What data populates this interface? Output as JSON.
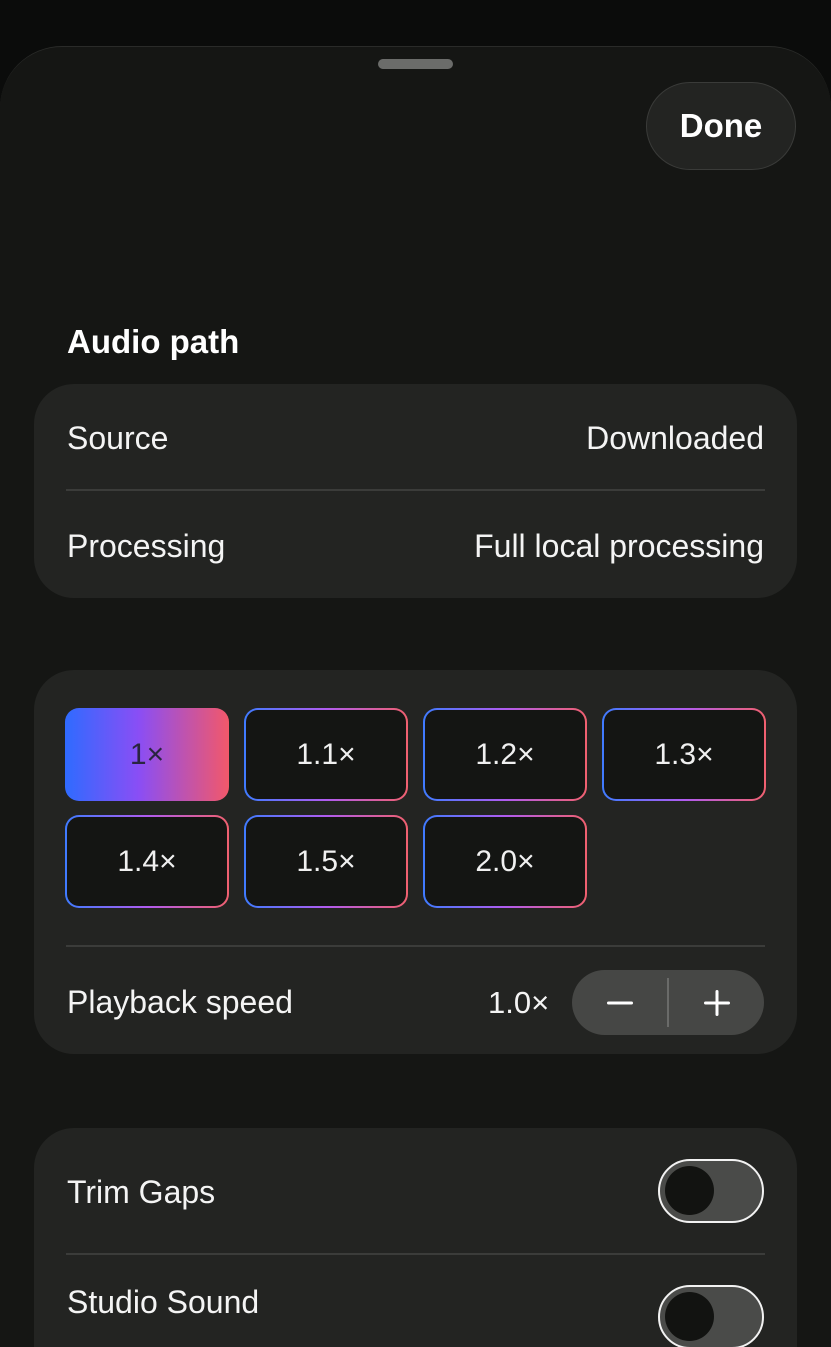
{
  "header": {
    "done_label": "Done"
  },
  "audio_path": {
    "title": "Audio path",
    "rows": [
      {
        "label": "Source",
        "value": "Downloaded"
      },
      {
        "label": "Processing",
        "value": "Full local processing"
      }
    ]
  },
  "speed": {
    "presets": [
      "1×",
      "1.1×",
      "1.2×",
      "1.3×",
      "1.4×",
      "1.5×",
      "2.0×"
    ],
    "selected": "1×",
    "playback_label": "Playback speed",
    "playback_value": "1.0×",
    "decrement_icon": "minus-icon",
    "increment_icon": "plus-icon",
    "gradient_colors": [
      "#3f7bff",
      "#b05cf0",
      "#f0606f"
    ]
  },
  "toggles": {
    "items": [
      {
        "label": "Trim Gaps",
        "on": false
      },
      {
        "label": "Studio Sound",
        "on": false
      }
    ]
  }
}
